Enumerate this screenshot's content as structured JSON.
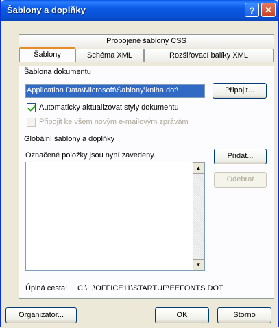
{
  "window": {
    "title": "Šablony a doplňky",
    "help_glyph": "?",
    "close_glyph": "✕"
  },
  "tabs": {
    "row_back": [
      {
        "label": "Propojené šablony CSS"
      }
    ],
    "row_front": [
      {
        "label": "Šablony",
        "selected": true
      },
      {
        "label": "Schéma XML"
      },
      {
        "label": "Rozšiřovací balíky XML"
      }
    ]
  },
  "document_template": {
    "group_label": "Šablona dokumentu",
    "path_value": "\\Application Data\\Microsoft\\Šablony\\kniha.dot",
    "attach_label": "Připojit...",
    "auto_update_label": "Automaticky aktualizovat styly dokumentu",
    "auto_update_checked": true,
    "attach_all_label": "Připojit ke všem novým e-mailovým zprávám",
    "attach_all_checked": false
  },
  "global_templates": {
    "group_label": "Globální šablony a doplňky",
    "loaded_label": "Označené položky jsou nyní zavedeny.",
    "add_label": "Přidat...",
    "remove_label": "Odebrat",
    "items": [],
    "full_path_label": "Úplná cesta:",
    "full_path_value": "C:\\...\\OFFICE11\\STARTUP\\EEFONTS.DOT",
    "scroll_up_glyph": "▲",
    "scroll_down_glyph": "▼"
  },
  "footer": {
    "organizer_label": "Organizátor...",
    "ok_label": "OK",
    "cancel_label": "Storno"
  }
}
